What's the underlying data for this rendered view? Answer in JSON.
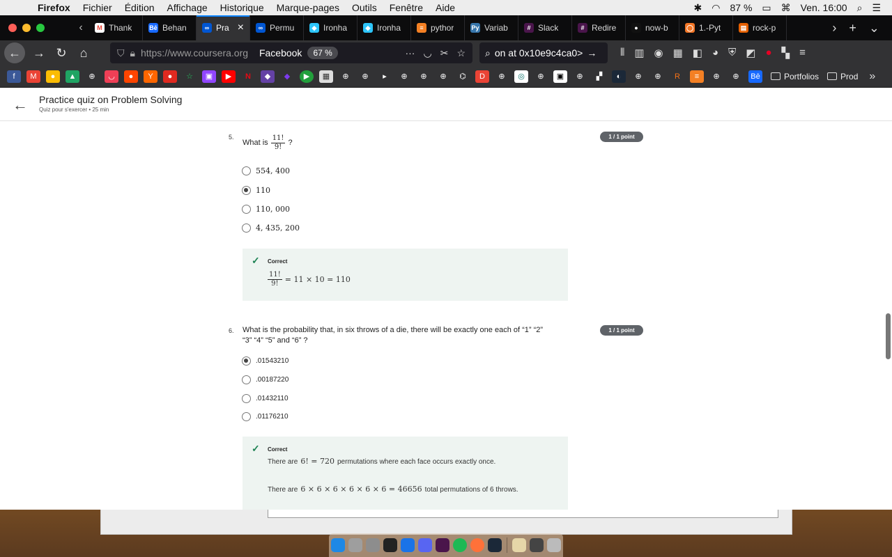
{
  "menubar": {
    "app_name": "Firefox",
    "menus": [
      "Fichier",
      "Édition",
      "Affichage",
      "Historique",
      "Marque-pages",
      "Outils",
      "Fenêtre",
      "Aide"
    ],
    "battery": "87 %",
    "clock": "Ven. 16:00"
  },
  "tabs": [
    {
      "label": "Thank",
      "favicon": "gmail-icon",
      "color": "#ffffff",
      "glyph": "M"
    },
    {
      "label": "Behan",
      "favicon": "behance-icon",
      "color": "#1769ff",
      "glyph": "Bē"
    },
    {
      "label": "Pra",
      "favicon": "coursera-icon",
      "color": "#0056d2",
      "glyph": "∞",
      "active": true
    },
    {
      "label": "Permu",
      "favicon": "coursera-icon",
      "color": "#0056d2",
      "glyph": "∞"
    },
    {
      "label": "Ironha",
      "favicon": "ironhack-icon",
      "color": "#2dc5fa",
      "glyph": "◆"
    },
    {
      "label": "Ironha",
      "favicon": "ironhack-icon",
      "color": "#2dc5fa",
      "glyph": "◆"
    },
    {
      "label": "pythor",
      "favicon": "stackoverflow-icon",
      "color": "#f48024",
      "glyph": "≡"
    },
    {
      "label": "Variab",
      "favicon": "python-icon",
      "color": "#3776ab",
      "glyph": "Py"
    },
    {
      "label": "Slack",
      "favicon": "slack-icon",
      "color": "#4a154b",
      "glyph": "#"
    },
    {
      "label": "Redire",
      "favicon": "slack-icon",
      "color": "#4a154b",
      "glyph": "#"
    },
    {
      "label": "now-b",
      "favicon": "github-icon",
      "color": "#111111",
      "glyph": "●"
    },
    {
      "label": "1.-Pyt",
      "favicon": "jupyter-icon",
      "color": "#f37626",
      "glyph": "◯"
    },
    {
      "label": "rock-p",
      "favicon": "book-icon",
      "color": "#e66000",
      "glyph": "▤"
    }
  ],
  "navbar": {
    "url": "https://www.coursera.org",
    "page_title": "Facebook",
    "zoom": "67 %",
    "search_text": "on at 0x10e9c4ca0>"
  },
  "bookmarks": {
    "folders": [
      "Portfolios",
      "Prod"
    ]
  },
  "page": {
    "title": "Practice quiz on Problem Solving",
    "subtitle": "Quiz pour s'exercer • 25  min"
  },
  "questions": [
    {
      "number": "5.",
      "prefix": "What is",
      "frac_num": "11!",
      "frac_den": "9!",
      "suffix": "?",
      "points": "1 / 1 point",
      "options": [
        "554, 400",
        "110",
        "110, 000",
        "4, 435, 200"
      ],
      "selected": 1,
      "feedback": {
        "label": "Correct",
        "frac_num": "11!",
        "frac_den": "9!",
        "expr": "= 11 × 10 = 110"
      }
    },
    {
      "number": "6.",
      "line1": "What is the probability that, in six throws of a die, there will be exactly one each of “1” “2”",
      "line2": "“3” “4” “5” and “6” ?",
      "points": "1 / 1 point",
      "options": [
        ".01543210",
        ".00187220",
        ".01432110",
        ".01176210"
      ],
      "selected": 0,
      "feedback": {
        "label": "Correct",
        "line1_pre": "There are",
        "line1_math": "6! = 720",
        "line1_post": "permutations where each face occurs exactly once.",
        "line2_pre": "There are",
        "line2_math": "6 × 6 × 6 × 6 × 6 × 6 = 46656",
        "line2_post": "total permutations of 6 throws."
      }
    }
  ]
}
